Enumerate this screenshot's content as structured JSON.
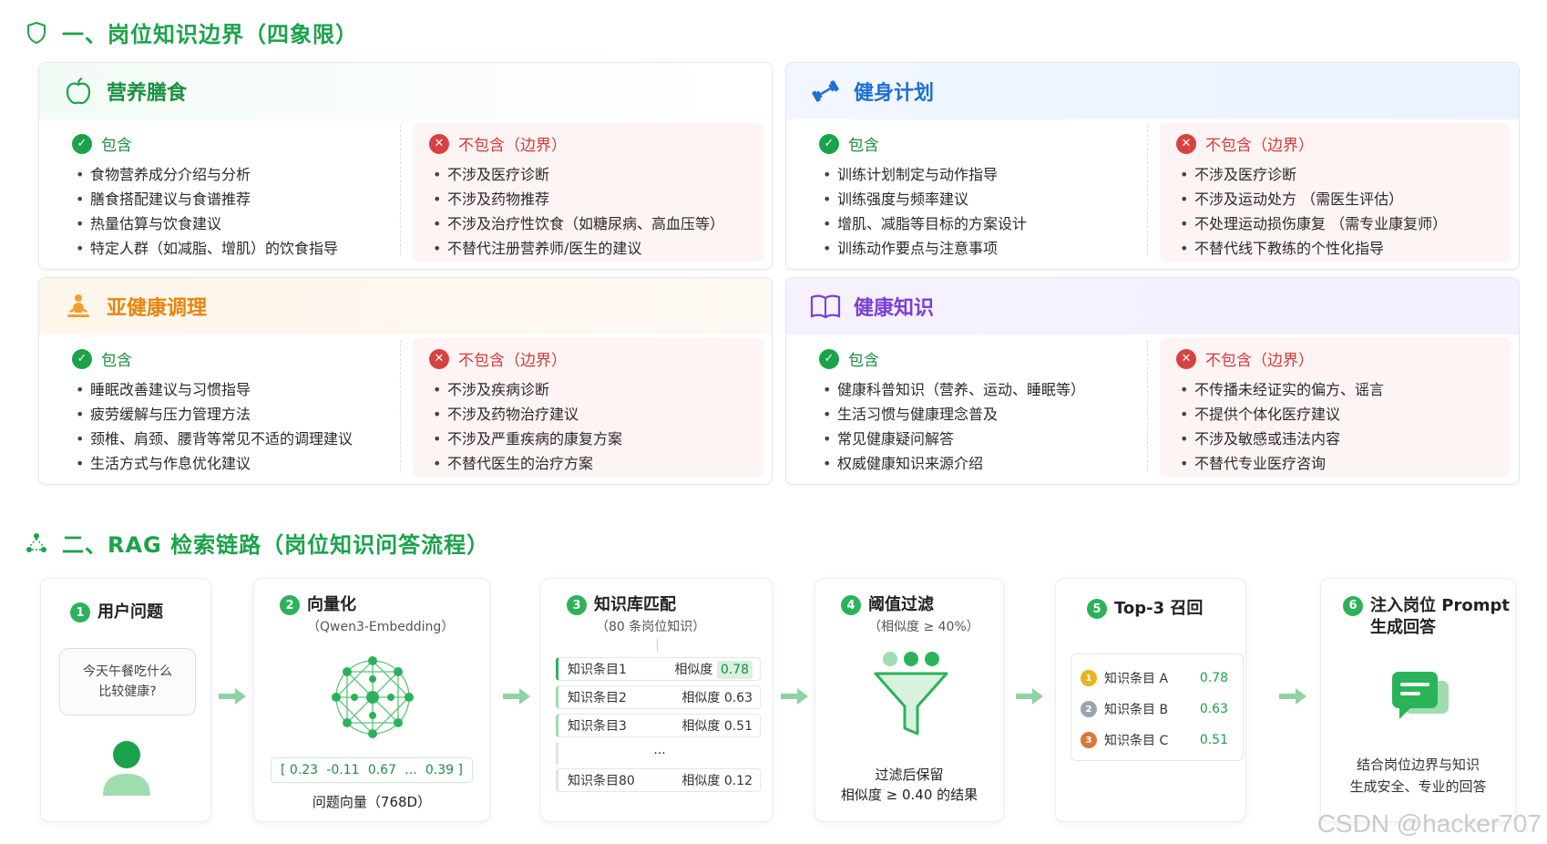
{
  "section1": {
    "title": "一、岗位知识边界（四象限）"
  },
  "section2": {
    "title": "二、RAG 检索链路（岗位知识问答流程）"
  },
  "quadrants": [
    {
      "title": "营养膳食",
      "icon": "apple-icon",
      "include_label": "包含",
      "exclude_label": "不包含（边界）",
      "include": [
        "食物营养成分介绍与分析",
        "膳食搭配建议与食谱推荐",
        "热量估算与饮食建议",
        "特定人群（如减脂、增肌）的饮食指导"
      ],
      "exclude": [
        "不涉及医疗诊断",
        "不涉及药物推荐",
        "不涉及治疗性饮食（如糖尿病、高血压等）",
        "不替代注册营养师/医生的建议"
      ]
    },
    {
      "title": "健身计划",
      "icon": "dumbbell-icon",
      "include_label": "包含",
      "exclude_label": "不包含（边界）",
      "include": [
        "训练计划制定与动作指导",
        "训练强度与频率建议",
        "增肌、减脂等目标的方案设计",
        "训练动作要点与注意事项"
      ],
      "exclude": [
        "不涉及医疗诊断",
        "不涉及运动处方 （需医生评估）",
        "不处理运动损伤康复 （需专业康复师）",
        "不替代线下教练的个性化指导"
      ]
    },
    {
      "title": "亚健康调理",
      "icon": "meditation-icon",
      "include_label": "包含",
      "exclude_label": "不包含（边界）",
      "include": [
        "睡眠改善建议与习惯指导",
        "疲劳缓解与压力管理方法",
        "颈椎、肩颈、腰背等常见不适的调理建议",
        "生活方式与作息优化建议"
      ],
      "exclude": [
        "不涉及疾病诊断",
        "不涉及药物治疗建议",
        "不涉及严重疾病的康复方案",
        "不替代医生的治疗方案"
      ]
    },
    {
      "title": "健康知识",
      "icon": "book-icon",
      "include_label": "包含",
      "exclude_label": "不包含（边界）",
      "include": [
        "健康科普知识（营养、运动、睡眠等）",
        "生活习惯与健康理念普及",
        "常见健康疑问解答",
        "权威健康知识来源介绍"
      ],
      "exclude": [
        "不传播未经证实的偏方、谣言",
        "不提供个体化医疗建议",
        "不涉及敏感或违法内容",
        "不替代专业医疗咨询"
      ]
    }
  ],
  "steps": {
    "s1": {
      "num": "1",
      "title": "用户问题",
      "question_line1": "今天午餐吃什么",
      "question_line2": "比较健康?"
    },
    "s2": {
      "num": "2",
      "title": "向量化",
      "sub": "（Qwen3-Embedding）",
      "vector": [
        "[ 0.23",
        "-0.11",
        "0.67",
        "...",
        "0.39 ]"
      ],
      "label": "问题向量（768D）"
    },
    "s3": {
      "num": "3",
      "title": "知识库匹配",
      "sub": "（80 条岗位知识）",
      "rows": [
        {
          "name": "知识条目1",
          "sim_label": "相似度",
          "sim": "0.78"
        },
        {
          "name": "知识条目2",
          "sim_label": "相似度",
          "sim": "0.63"
        },
        {
          "name": "知识条目3",
          "sim_label": "相似度",
          "sim": "0.51"
        },
        {
          "name": "知识条目80",
          "sim_label": "相似度",
          "sim": "0.12"
        }
      ],
      "ellipsis": "..."
    },
    "s4": {
      "num": "4",
      "title": "阈值过滤",
      "sub": "（相似度 ≥ 40%）",
      "result_line1": "过滤后保留",
      "result_line2": "相似度 ≥ 0.40 的结果"
    },
    "s5": {
      "num": "5",
      "title": "Top-3 召回",
      "results": [
        {
          "name": "知识条目 A",
          "score": "0.78",
          "medal": "gold"
        },
        {
          "name": "知识条目 B",
          "score": "0.63",
          "medal": "silver"
        },
        {
          "name": "知识条目 C",
          "score": "0.51",
          "medal": "bronze"
        }
      ]
    },
    "s6": {
      "num": "6",
      "title_line1": "注入岗位 Prompt",
      "title_line2": "生成回答",
      "desc_line1": "结合岗位边界与知识",
      "desc_line2": "生成安全、专业的回答"
    }
  },
  "colors": {
    "green": "#1aa34a",
    "red": "#d94141",
    "blue": "#1d6fd6",
    "orange": "#e8850c",
    "purple": "#7a3fd6"
  },
  "watermark": "CSDN @hacker707"
}
